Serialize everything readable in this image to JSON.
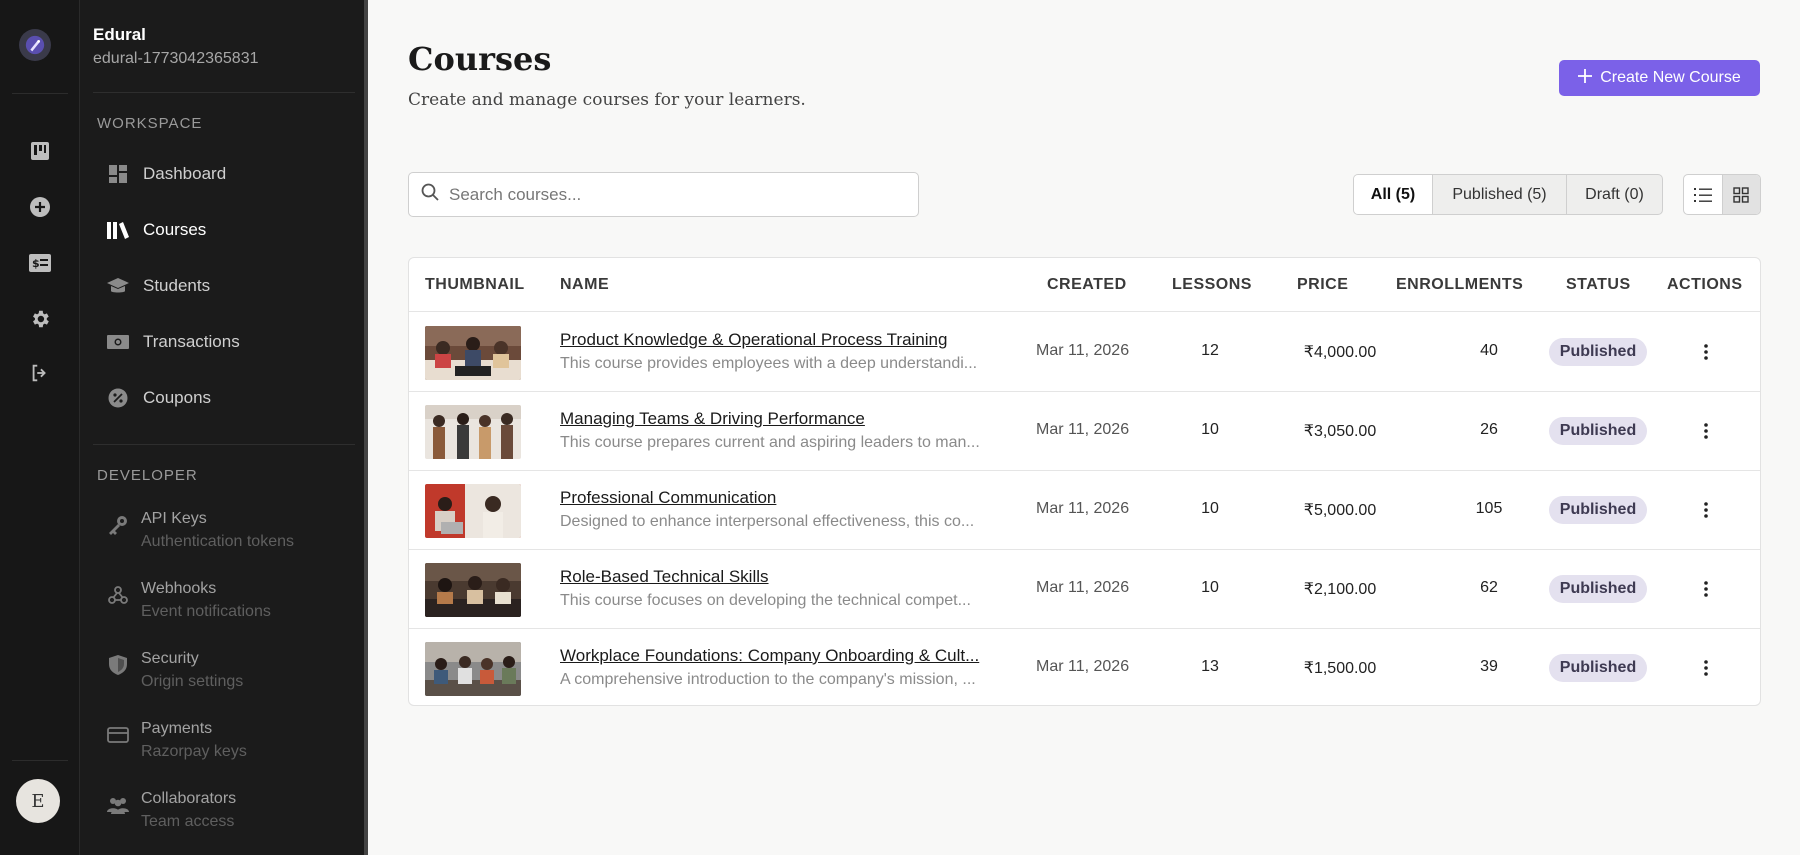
{
  "app": {
    "org_name": "Edural",
    "org_id": "edural-1773042365831",
    "avatar_initial": "E",
    "accent_color": "#7b61e8"
  },
  "sidebar": {
    "workspace_title": "WORKSPACE",
    "workspace_items": [
      {
        "label": "Dashboard",
        "icon": "grid-icon"
      },
      {
        "label": "Courses",
        "icon": "books-icon",
        "active": true
      },
      {
        "label": "Students",
        "icon": "graduation-cap-icon"
      },
      {
        "label": "Transactions",
        "icon": "banknote-icon"
      },
      {
        "label": "Coupons",
        "icon": "percent-badge-icon"
      }
    ],
    "developer_title": "DEVELOPER",
    "developer_items": [
      {
        "label": "API Keys",
        "sub": "Authentication tokens",
        "icon": "key-icon"
      },
      {
        "label": "Webhooks",
        "sub": "Event notifications",
        "icon": "webhook-icon"
      },
      {
        "label": "Security",
        "sub": "Origin settings",
        "icon": "shield-icon"
      },
      {
        "label": "Payments",
        "sub": "Razorpay keys",
        "icon": "credit-card-icon"
      },
      {
        "label": "Collaborators",
        "sub": "Team access",
        "icon": "users-icon"
      }
    ]
  },
  "header": {
    "title": "Courses",
    "subtitle": "Create and manage courses for your learners.",
    "create_button": "Create New Course"
  },
  "search": {
    "placeholder": "Search courses...",
    "value": ""
  },
  "filters": [
    {
      "label": "All (5)",
      "active": true
    },
    {
      "label": "Published (5)",
      "active": false
    },
    {
      "label": "Draft (0)",
      "active": false
    }
  ],
  "view_mode": "grid",
  "table": {
    "columns": [
      "THUMBNAIL",
      "NAME",
      "CREATED",
      "LESSONS",
      "PRICE",
      "ENROLLMENTS",
      "STATUS",
      "ACTIONS"
    ],
    "rows": [
      {
        "title": "Product Knowledge & Operational Process Training",
        "desc": "This course provides employees with a deep understandi...",
        "created": "Mar 11, 2026",
        "lessons": "12",
        "price": "₹4,000.00",
        "enrollments": "40",
        "status": "Published"
      },
      {
        "title": "Managing Teams & Driving Performance",
        "desc": "This course prepares current and aspiring leaders to man...",
        "created": "Mar 11, 2026",
        "lessons": "10",
        "price": "₹3,050.00",
        "enrollments": "26",
        "status": "Published"
      },
      {
        "title": "Professional Communication",
        "desc": "Designed to enhance interpersonal effectiveness, this co...",
        "created": "Mar 11, 2026",
        "lessons": "10",
        "price": "₹5,000.00",
        "enrollments": "105",
        "status": "Published"
      },
      {
        "title": "Role-Based Technical Skills",
        "desc": "This course focuses on developing the technical compet...",
        "created": "Mar 11, 2026",
        "lessons": "10",
        "price": "₹2,100.00",
        "enrollments": "62",
        "status": "Published"
      },
      {
        "title": "Workplace Foundations: Company Onboarding & Cult...",
        "desc": "A comprehensive introduction to the company's mission, ...",
        "created": "Mar 11, 2026",
        "lessons": "13",
        "price": "₹1,500.00",
        "enrollments": "39",
        "status": "Published"
      }
    ]
  }
}
